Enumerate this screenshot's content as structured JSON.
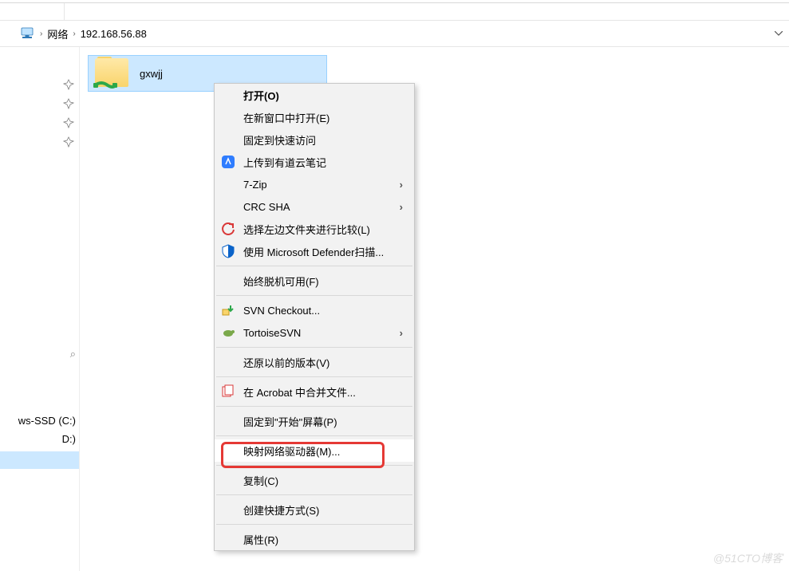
{
  "breadcrumb": {
    "root": "网络",
    "address": "192.168.56.88"
  },
  "folder": {
    "name": "gxwjj"
  },
  "sidebar": {
    "pins": [
      "",
      "",
      "",
      ""
    ],
    "drive_c": "ws-SSD (C:)",
    "drive_d": "D:)"
  },
  "contextMenu": {
    "open": "打开(O)",
    "open_new_window": "在新窗口中打开(E)",
    "pin_quick": "固定到快速访问",
    "youdao": "上传到有道云笔记",
    "sevenzip": "7-Zip",
    "crc_sha": "CRC SHA",
    "compare_left": "选择左边文件夹进行比较(L)",
    "defender": "使用 Microsoft Defender扫描...",
    "offline": "始终脱机可用(F)",
    "svn_checkout": "SVN Checkout...",
    "tortoise": "TortoiseSVN",
    "restore_prev": "还原以前的版本(V)",
    "acrobat": "在 Acrobat 中合并文件...",
    "pin_start": "固定到\"开始\"屏幕(P)",
    "map_drive": "映射网络驱动器(M)...",
    "copy": "复制(C)",
    "shortcut": "创建快捷方式(S)",
    "properties": "属性(R)"
  },
  "watermark": "@51CTO博客"
}
